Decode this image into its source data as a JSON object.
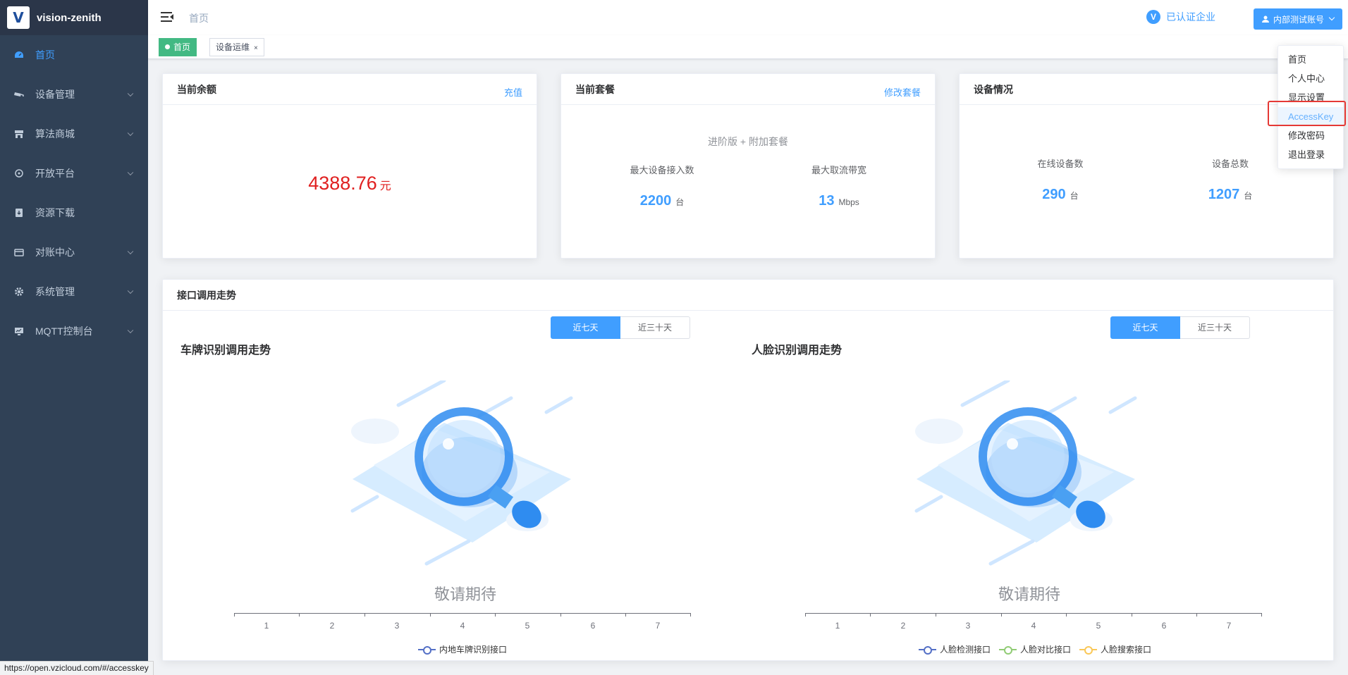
{
  "app": {
    "name": "vision-zenith",
    "logo_letter": "V"
  },
  "sidebar": {
    "items": [
      {
        "label": "首页",
        "icon": "dashboard-icon",
        "active": true,
        "expandable": false
      },
      {
        "label": "设备管理",
        "icon": "camera-icon",
        "expandable": true
      },
      {
        "label": "算法商城",
        "icon": "shop-icon",
        "expandable": true
      },
      {
        "label": "开放平台",
        "icon": "platform-icon",
        "expandable": true
      },
      {
        "label": "资源下载",
        "icon": "download-icon",
        "expandable": false
      },
      {
        "label": "对账中心",
        "icon": "bill-icon",
        "expandable": true
      },
      {
        "label": "系统管理",
        "icon": "gear-icon",
        "expandable": true
      },
      {
        "label": "MQTT控制台",
        "icon": "monitor-icon",
        "expandable": true
      }
    ]
  },
  "header": {
    "breadcrumb": "首页",
    "verified_label": "已认证企业",
    "verified_badge": "V",
    "account_label": "内部测试账号"
  },
  "tags": [
    {
      "label": "首页",
      "active": true
    },
    {
      "label": "设备运维",
      "active": false,
      "close": "×"
    }
  ],
  "balance_card": {
    "title": "当前余额",
    "link": "充值",
    "amount": "4388.76",
    "unit": "元"
  },
  "plan_card": {
    "title": "当前套餐",
    "link": "修改套餐",
    "plan_name": "进阶版 + 附加套餐",
    "max_devices_label": "最大设备接入数",
    "max_devices_value": "2200",
    "max_devices_unit": "台",
    "max_bandwidth_label": "最大取流带宽",
    "max_bandwidth_value": "13",
    "max_bandwidth_unit": "Mbps"
  },
  "device_card": {
    "title": "设备情况",
    "online_label": "在线设备数",
    "online_value": "290",
    "online_unit": "台",
    "total_label": "设备总数",
    "total_value": "1207",
    "total_unit": "台"
  },
  "trend": {
    "title": "接口调用走势",
    "range_options": [
      "近七天",
      "近三十天"
    ],
    "selected_range": "近七天",
    "empty_text": "敬请期待",
    "x_ticks": [
      "1",
      "2",
      "3",
      "4",
      "5",
      "6",
      "7"
    ],
    "plate_chart": {
      "title": "车牌识别调用走势",
      "legend": [
        {
          "name": "内地车牌识别接口",
          "color": "#5470c6"
        }
      ]
    },
    "face_chart": {
      "title": "人脸识别调用走势",
      "legend": [
        {
          "name": "人脸检测接口",
          "color": "#5470c6"
        },
        {
          "name": "人脸对比接口",
          "color": "#91cc75"
        },
        {
          "name": "人脸搜索接口",
          "color": "#fac858"
        }
      ]
    }
  },
  "account_menu": {
    "items": [
      "首页",
      "个人中心",
      "显示设置",
      "AccessKey",
      "修改密码",
      "退出登录"
    ],
    "highlighted": "AccessKey"
  },
  "status_url": "https://open.vzicloud.com/#/accesskey"
}
